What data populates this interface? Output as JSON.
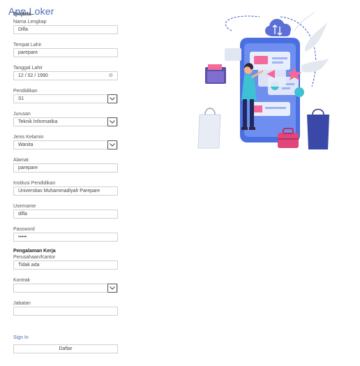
{
  "app_title": "App Loker",
  "biodata_label": "Biodata",
  "fields": {
    "nama_lengkap": {
      "label": "Nama Lengkap",
      "value": "Difla"
    },
    "tempat_lahir": {
      "label": "Tempat Lahir",
      "value": "parepare"
    },
    "tanggal_lahir": {
      "label": "Tanggal Lahir",
      "value": "12 / 02 / 1990"
    },
    "pendidikan": {
      "label": "Pendidikan",
      "value": "S1"
    },
    "jurusan": {
      "label": "Jurusan",
      "value": "Teknik Informatika"
    },
    "jenis_kelamin": {
      "label": "Jenis Kelamin",
      "value": "Wanita"
    },
    "alamat": {
      "label": "Alamat",
      "value": "parepare"
    },
    "institusi": {
      "label": "Institusi Pendidikan",
      "value": "Universitas Muhammadiyah Parepare"
    },
    "username": {
      "label": "Username",
      "value": "difla"
    },
    "password": {
      "label": "Password",
      "value": "•••••"
    }
  },
  "pengalaman": {
    "section_title": "Pengalaman Kerja",
    "perusahaan": {
      "label": "Perusahaan/Kantor",
      "value": "Tidak ada"
    },
    "kontrak": {
      "label": "Kontrak",
      "value": ""
    },
    "jabatan": {
      "label": "Jabatan",
      "value": ""
    }
  },
  "links": {
    "sign_in": "Sign In"
  },
  "buttons": {
    "daftar": "Daftar"
  },
  "icons": {
    "select": "chevron-down-icon",
    "date": "calendar-icon"
  }
}
